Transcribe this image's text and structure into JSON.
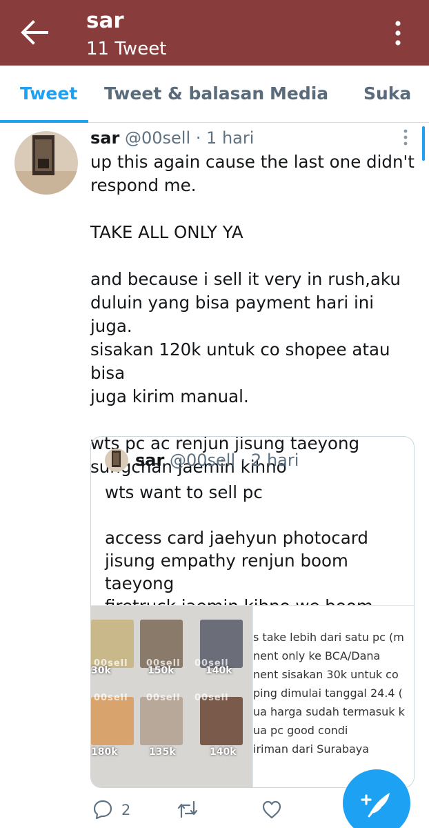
{
  "header": {
    "name": "sar",
    "tweet_count": "11 Tweet",
    "bg_color": "#883c3c",
    "back_icon": "arrow-left-icon",
    "menu_icon": "more-vertical-icon"
  },
  "tabs": [
    {
      "label": "Tweet",
      "active": true
    },
    {
      "label": "Tweet & balasan",
      "active": false
    },
    {
      "label": "Media",
      "active": false
    },
    {
      "label": "Suka",
      "active": false
    }
  ],
  "tweet": {
    "name": "sar",
    "handle": "@00sell",
    "separator": "·",
    "time": "1 hari",
    "lines": [
      "up this again cause the last one didn't",
      "respond me.",
      "",
      "TAKE ALL ONLY YA",
      "",
      "and because i sell it very in rush,aku",
      "duluin yang bisa payment hari ini juga.",
      "sisakan 120k untuk co shopee atau bisa",
      "juga kirim manual.",
      "",
      "wts pc ac renjun jisung taeyong",
      "sungchan jaemin kihno"
    ],
    "reply_count": "2"
  },
  "quote": {
    "name": "sar",
    "handle": "@00sell",
    "separator": "·",
    "time": "2 hari",
    "lines": [
      "wts want to sell pc",
      "",
      "access card jaehyun photocard",
      "jisung empathy renjun boom taeyong",
      "firetruck jaemin kihno we boom renj..."
    ],
    "prices": [
      "30k",
      "150k",
      "140k",
      "180k",
      "135k",
      "140k"
    ],
    "watermark": "00sell",
    "notes": [
      "s take lebih dari satu pc (m",
      "nent only ke BCA/Dana",
      "nent sisakan 30k untuk co",
      "ping dimulai tanggal 24.4 (",
      "ua harga sudah termasuk k",
      "ua pc good condi",
      "iriman dari Surabaya"
    ]
  },
  "actions": {
    "reply_icon": "reply-icon",
    "retweet_icon": "retweet-icon",
    "like_icon": "heart-icon",
    "compose_icon": "compose-tweet-icon"
  },
  "colors": {
    "accent": "#1da1f2",
    "muted": "#5f7282"
  }
}
